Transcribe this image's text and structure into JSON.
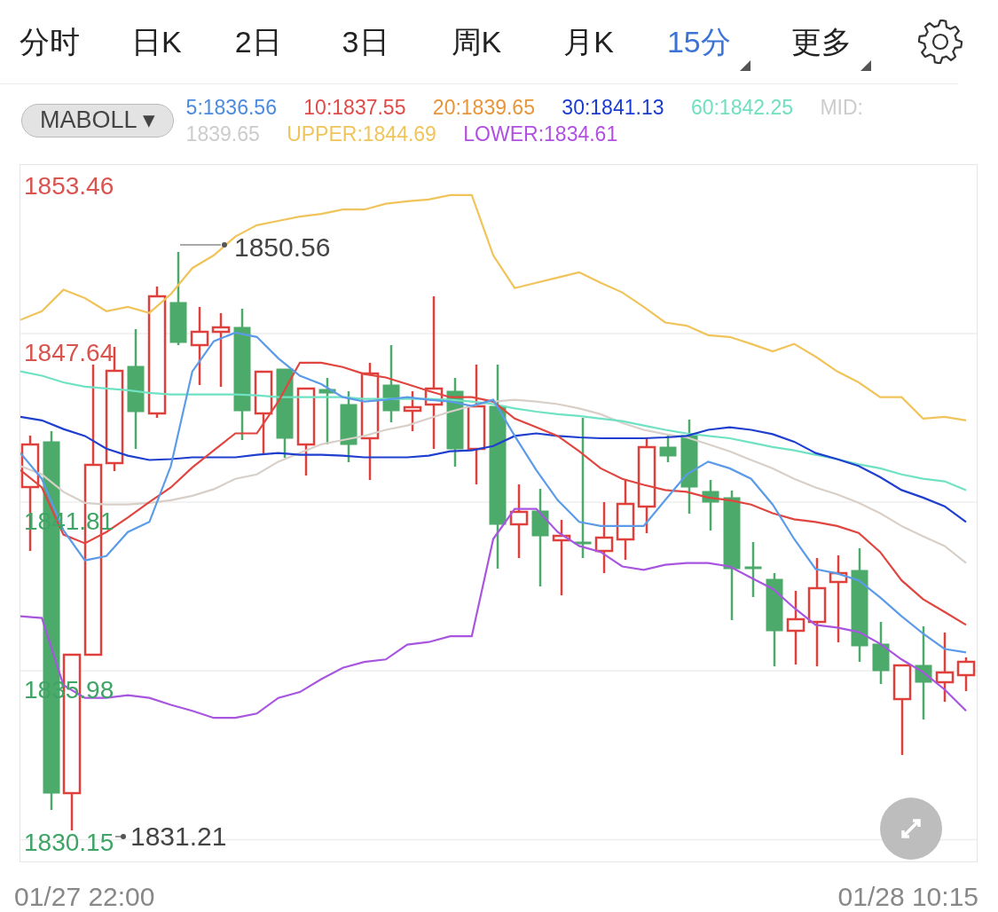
{
  "tabs": [
    {
      "label": "分时",
      "selected": false,
      "has_menu": false
    },
    {
      "label": "日K",
      "selected": false,
      "has_menu": false
    },
    {
      "label": "2日",
      "selected": false,
      "has_menu": false
    },
    {
      "label": "3日",
      "selected": false,
      "has_menu": false
    },
    {
      "label": "周K",
      "selected": false,
      "has_menu": false
    },
    {
      "label": "月K",
      "selected": false,
      "has_menu": false
    },
    {
      "label": "15分",
      "selected": true,
      "has_menu": true
    },
    {
      "label": "更多",
      "selected": false,
      "has_menu": true
    }
  ],
  "indicator_dropdown": {
    "label": "MABOLL",
    "caret": "▾"
  },
  "legend": [
    {
      "text": "5:1836.56",
      "color": "#4a8be0"
    },
    {
      "text": "10:1837.55",
      "color": "#e04a48"
    },
    {
      "text": "20:1839.65",
      "color": "#e8953a"
    },
    {
      "text": "30:1841.13",
      "color": "#1a3bd0"
    },
    {
      "text": "60:1842.25",
      "color": "#6ee0c0"
    },
    {
      "text": "MID:",
      "color": "#cccccc"
    },
    {
      "text": "1839.65",
      "color": "#cccccc"
    },
    {
      "text": "UPPER:1844.69",
      "color": "#f0c45a"
    },
    {
      "text": "LOWER:1834.61",
      "color": "#b050e0"
    }
  ],
  "chart": {
    "y_labels": [
      {
        "text": "1853.46",
        "color": "#d9534f"
      },
      {
        "text": "1847.64",
        "color": "#d9534f"
      },
      {
        "text": "1841.81",
        "color": "#3fa465"
      },
      {
        "text": "1835.98",
        "color": "#3fa465"
      },
      {
        "text": "1830.15",
        "color": "#3fa465"
      }
    ],
    "high_marker": "1850.56",
    "low_marker": "1831.21",
    "x_start": "01/27 22:00",
    "x_end": "01/28 10:15",
    "chart_data": {
      "type": "line",
      "ylim": [
        1829.4,
        1853.46
      ],
      "yticks": [
        1830.15,
        1835.98,
        1841.81,
        1847.64,
        1853.46
      ],
      "grid": true,
      "series": [
        {
          "color": "#f0c45a",
          "values": [
            1848.11,
            1848.41,
            1849.15,
            1848.86,
            1848.41,
            1848.56,
            1848.35,
            1849.0,
            1849.9,
            1850.34,
            1850.99,
            1851.38,
            1851.53,
            1851.68,
            1851.77,
            1851.92,
            1851.92,
            1852.12,
            1852.21,
            1852.27,
            1852.42,
            1852.42,
            1850.34,
            1849.21,
            1849.39,
            1849.57,
            1849.75,
            1849.39,
            1849.06,
            1848.56,
            1848.02,
            1847.91,
            1847.58,
            1847.52,
            1847.28,
            1847.02,
            1847.28,
            1846.84,
            1846.33,
            1845.95,
            1845.44,
            1845.44,
            1844.7,
            1844.76,
            1844.64
          ]
        },
        {
          "color": "#a855e0",
          "values": [
            1837.87,
            1837.81,
            1835.49,
            1835.05,
            1835.05,
            1835.14,
            1835.05,
            1834.81,
            1834.6,
            1834.36,
            1834.36,
            1834.51,
            1835.05,
            1835.25,
            1835.7,
            1836.09,
            1836.29,
            1836.38,
            1836.89,
            1836.98,
            1837.18,
            1837.18,
            1840.54,
            1841.58,
            1841.58,
            1840.78,
            1840.3,
            1840.09,
            1839.59,
            1839.47,
            1839.65,
            1839.71,
            1839.71,
            1839.59,
            1839.2,
            1838.82,
            1838.16,
            1837.57,
            1837.48,
            1837.33,
            1836.92,
            1836.38,
            1835.94,
            1835.34,
            1834.6
          ]
        },
        {
          "color": "#d8d0c8",
          "values": [
            1843.06,
            1842.77,
            1842.17,
            1841.79,
            1841.73,
            1841.73,
            1841.79,
            1841.88,
            1842.03,
            1842.26,
            1842.62,
            1842.77,
            1843.21,
            1843.51,
            1843.81,
            1843.96,
            1844.1,
            1844.31,
            1844.46,
            1844.7,
            1844.94,
            1845.14,
            1845.29,
            1845.35,
            1845.29,
            1845.2,
            1845.05,
            1844.85,
            1844.55,
            1844.31,
            1844.16,
            1844.05,
            1843.81,
            1843.57,
            1843.27,
            1842.98,
            1842.62,
            1842.32,
            1842.08,
            1841.79,
            1841.43,
            1840.99,
            1840.63,
            1840.3,
            1839.71
          ]
        },
        {
          "color": "#6fe2c4",
          "values": [
            1846.33,
            1846.18,
            1845.95,
            1845.8,
            1845.74,
            1845.68,
            1845.59,
            1845.53,
            1845.53,
            1845.53,
            1845.53,
            1845.5,
            1845.44,
            1845.44,
            1845.44,
            1845.44,
            1845.38,
            1845.38,
            1845.38,
            1845.38,
            1845.35,
            1845.29,
            1845.2,
            1845.05,
            1844.94,
            1844.85,
            1844.79,
            1844.7,
            1844.61,
            1844.46,
            1844.31,
            1844.19,
            1844.1,
            1844.02,
            1843.87,
            1843.72,
            1843.6,
            1843.45,
            1843.3,
            1843.12,
            1842.98,
            1842.77,
            1842.62,
            1842.53,
            1842.23
          ]
        },
        {
          "color": "#1f3fcf",
          "values": [
            1844.76,
            1844.64,
            1844.34,
            1844.1,
            1843.66,
            1843.42,
            1843.27,
            1843.3,
            1843.36,
            1843.36,
            1843.36,
            1843.45,
            1843.51,
            1843.45,
            1843.45,
            1843.42,
            1843.36,
            1843.36,
            1843.36,
            1843.42,
            1843.57,
            1843.6,
            1843.75,
            1844.1,
            1844.19,
            1844.1,
            1844.05,
            1844.02,
            1844.02,
            1844.02,
            1844.05,
            1844.1,
            1844.31,
            1844.4,
            1844.31,
            1844.16,
            1843.9,
            1843.51,
            1843.3,
            1843.06,
            1842.68,
            1842.23,
            1841.97,
            1841.67,
            1841.13
          ]
        },
        {
          "color": "#e0453f",
          "values": [
            1842.92,
            1842.32,
            1840.69,
            1840.39,
            1840.78,
            1841.28,
            1841.82,
            1842.32,
            1843.01,
            1843.6,
            1844.19,
            1844.19,
            1845.29,
            1846.63,
            1846.63,
            1846.48,
            1846.24,
            1846.12,
            1845.89,
            1845.65,
            1845.44,
            1845.44,
            1845.29,
            1844.7,
            1844.4,
            1844.1,
            1843.57,
            1842.98,
            1842.62,
            1842.41,
            1842.23,
            1842.17,
            1841.97,
            1841.88,
            1841.73,
            1841.43,
            1841.22,
            1841.13,
            1840.99,
            1840.75,
            1840.09,
            1839.11,
            1838.46,
            1838.02,
            1837.57
          ]
        },
        {
          "color": "#5b9be8",
          "values": [
            1843.51,
            1842.62,
            1840.84,
            1839.8,
            1839.95,
            1840.78,
            1841.13,
            1843.06,
            1846.33,
            1847.37,
            1847.67,
            1847.52,
            1846.78,
            1846.18,
            1845.89,
            1845.44,
            1845.29,
            1845.35,
            1845.44,
            1845.35,
            1845.29,
            1845.14,
            1845.35,
            1844.1,
            1842.92,
            1841.88,
            1841.13,
            1840.99,
            1840.99,
            1840.99,
            1841.88,
            1842.77,
            1843.21,
            1842.98,
            1842.62,
            1841.73,
            1840.54,
            1839.5,
            1839.35,
            1839.11,
            1838.52,
            1837.87,
            1837.27,
            1836.74,
            1836.62
          ]
        }
      ]
    }
  }
}
